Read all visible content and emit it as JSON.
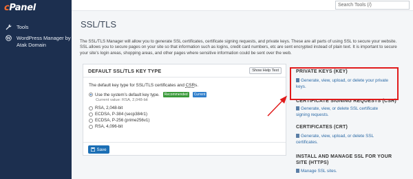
{
  "brand": {
    "logo": "cPanel"
  },
  "sidebar": {
    "items": [
      {
        "label": "Tools",
        "icon": "wrench-icon"
      },
      {
        "label": "WordPress Manager by Atak Domain",
        "icon": "wordpress-icon"
      }
    ]
  },
  "search": {
    "placeholder": "Search Tools (/)"
  },
  "page": {
    "title": "SSL/TLS",
    "intro": "The SSL/TLS Manager will allow you to generate SSL certificates, certificate signing requests, and private keys. These are all parts of using SSL to secure your website. SSL allows you to secure pages on your site so that information such as logins, credit card numbers, etc are sent encrypted instead of plain text. It is important to secure your site’s login areas, shopping areas, and other pages where sensitive information could be sent over the web."
  },
  "panel": {
    "title": "DEFAULT SSL/TLS KEY TYPE",
    "help_label": "Show Help Text",
    "description_prefix": "The default key type for SSL/TLS certificates and ",
    "description_abbr": "CSR",
    "description_suffix": "s.",
    "default_option": "Use the system’s default key type.",
    "badge_recommended": "Recommended",
    "badge_current": "Current",
    "current_value": "Current value: RSA, 2,048-bit",
    "options": [
      "RSA, 2,048-bit",
      "ECDSA, P-384 (secp384r1)",
      "ECDSA, P-256 (prime256v1)",
      "RSA, 4,096-bit"
    ],
    "save_label": "Save"
  },
  "sections": [
    {
      "title": "PRIVATE KEYS (KEY)",
      "link": "Generate, view, upload, or delete your private keys."
    },
    {
      "title": "CERTIFICATE SIGNING REQUESTS (CSR)",
      "link": "Generate, view, or delete SSL certificate signing requests."
    },
    {
      "title": "CERTIFICATES (CRT)",
      "link": "Generate, view, upload, or delete SSL certificates."
    },
    {
      "title": "INSTALL AND MANAGE SSL FOR YOUR SITE (HTTPS)",
      "link": "Manage SSL sites."
    }
  ],
  "colors": {
    "sidebar_bg": "#1c2f4f",
    "link": "#2c6aa6",
    "highlight": "#e11a1a",
    "save_button": "#1b6fb5"
  }
}
